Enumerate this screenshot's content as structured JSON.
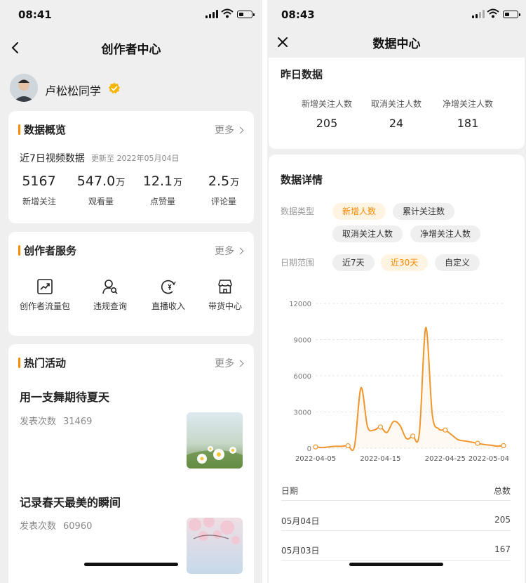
{
  "left": {
    "status_time": "08:41",
    "nav_title": "创作者中心",
    "user_name": "卢松松同学",
    "overview": {
      "title": "数据概览",
      "more": "更多",
      "subtitle": "近7日视频数据",
      "updated": "更新至 2022年05月04日",
      "stats": [
        {
          "num": "5167",
          "unit": "",
          "label": "新增关注"
        },
        {
          "num": "547.0",
          "unit": "万",
          "label": "观看量"
        },
        {
          "num": "12.1",
          "unit": "万",
          "label": "点赞量"
        },
        {
          "num": "2.5",
          "unit": "万",
          "label": "评论量"
        }
      ]
    },
    "services": {
      "title": "创作者服务",
      "more": "更多",
      "items": [
        {
          "label": "创作者流量包",
          "icon": "traffic-chart-icon"
        },
        {
          "label": "违规查询",
          "icon": "user-search-icon"
        },
        {
          "label": "直播收入",
          "icon": "yen-coin-icon"
        },
        {
          "label": "带货中心",
          "icon": "storefront-icon"
        }
      ]
    },
    "activities": {
      "title": "热门活动",
      "more": "更多",
      "items": [
        {
          "title": "用一支舞期待夏天",
          "meta_label": "发表次数",
          "count": "31469"
        },
        {
          "title": "记录春天最美的瞬间",
          "meta_label": "发表次数",
          "count": "60960"
        }
      ]
    }
  },
  "right": {
    "status_time": "08:43",
    "nav_title": "数据中心",
    "yesterday": {
      "title": "昨日数据",
      "stats": [
        {
          "label": "新增关注人数",
          "value": "205"
        },
        {
          "label": "取消关注人数",
          "value": "24"
        },
        {
          "label": "净增关注人数",
          "value": "181"
        }
      ]
    },
    "details": {
      "title": "数据详情",
      "type_label": "数据类型",
      "type_options": [
        "新增人数",
        "累计关注数",
        "取消关注人数",
        "净增关注人数"
      ],
      "type_selected": "新增人数",
      "range_label": "日期范围",
      "range_options": [
        "近7天",
        "近30天",
        "自定义"
      ],
      "range_selected": "近30天"
    },
    "table": {
      "col_date": "日期",
      "col_total": "总数",
      "rows": [
        {
          "date": "05月04日",
          "total": "205"
        },
        {
          "date": "05月03日",
          "total": "167"
        }
      ]
    }
  },
  "chart_data": {
    "type": "line",
    "title": "",
    "xlabel": "",
    "ylabel": "",
    "ylim": [
      0,
      12000
    ],
    "yticks": [
      0,
      3000,
      6000,
      9000,
      12000
    ],
    "xticks": [
      "2022-04-05",
      "2022-04-15",
      "2022-04-25",
      "2022-05-04"
    ],
    "grid": true,
    "color": "#f0962e",
    "series": [
      {
        "x": [
          "2022-04-05",
          "2022-04-06",
          "2022-04-07",
          "2022-04-08",
          "2022-04-09",
          "2022-04-10",
          "2022-04-11",
          "2022-04-12",
          "2022-04-13",
          "2022-04-14",
          "2022-04-15",
          "2022-04-16",
          "2022-04-17",
          "2022-04-18",
          "2022-04-19",
          "2022-04-20",
          "2022-04-21",
          "2022-04-22",
          "2022-04-23",
          "2022-04-24",
          "2022-04-25",
          "2022-04-26",
          "2022-04-27",
          "2022-04-28",
          "2022-04-29",
          "2022-04-30",
          "2022-05-01",
          "2022-05-02",
          "2022-05-03",
          "2022-05-04"
        ],
        "y": [
          100,
          50,
          100,
          150,
          150,
          200,
          150,
          5000,
          1800,
          1500,
          1750,
          1300,
          2200,
          1900,
          800,
          1000,
          1200,
          10000,
          2800,
          1600,
          1500,
          1100,
          700,
          600,
          500,
          400,
          300,
          250,
          167,
          205
        ]
      }
    ]
  }
}
